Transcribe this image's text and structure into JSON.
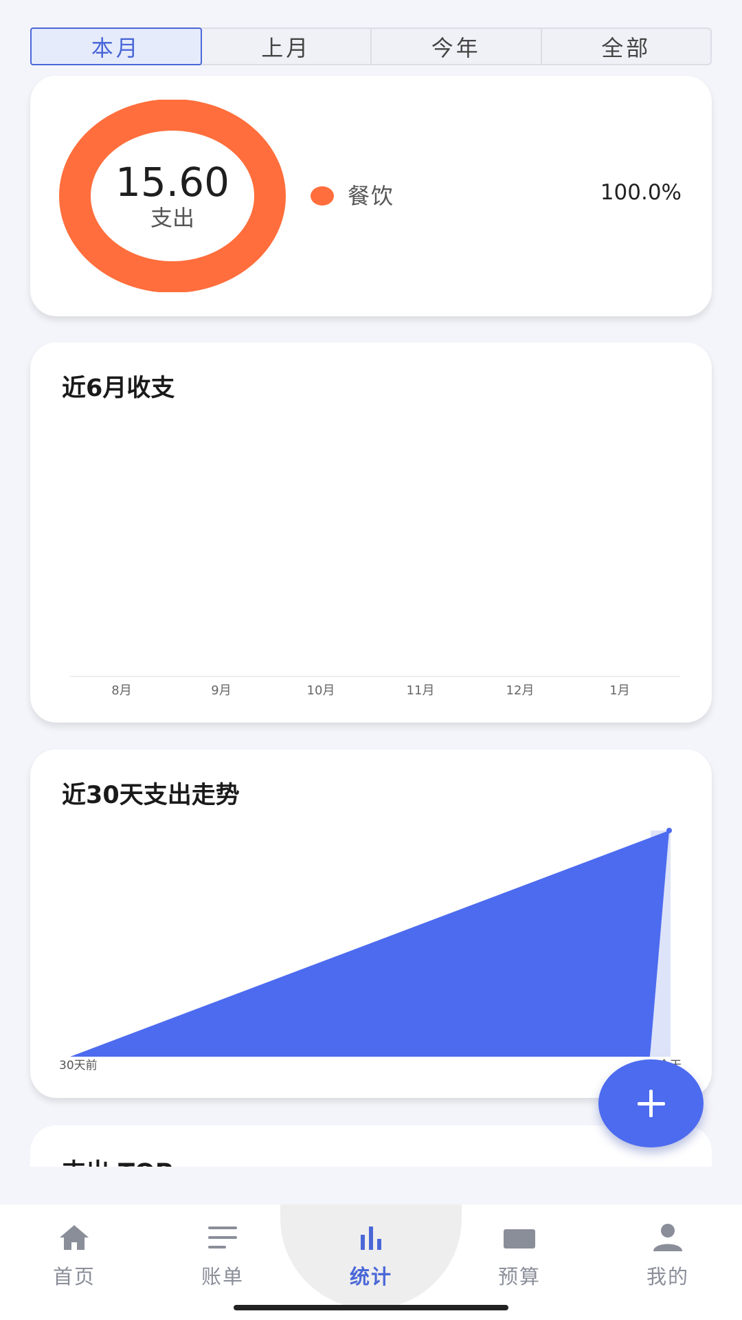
{
  "tabs": [
    {
      "label": "本月",
      "active": true
    },
    {
      "label": "上月",
      "active": false
    },
    {
      "label": "今年",
      "active": false
    },
    {
      "label": "全部",
      "active": false
    }
  ],
  "donut": {
    "amount": "15.60",
    "label": "支出",
    "segments": [
      {
        "name": "餐饮",
        "percent": "100.0%",
        "fraction": 1.0,
        "color": "#ff6e3c"
      }
    ]
  },
  "six_month": {
    "title": "近6月收支",
    "months": [
      "8月",
      "9月",
      "10月",
      "11月",
      "12月",
      "1月"
    ]
  },
  "trend": {
    "title": "近30天支出走势",
    "start_label": "30天前",
    "end_label": "今天",
    "fill_color": "#4d6bef"
  },
  "chart_data": [
    {
      "type": "bar",
      "title": "近6月收支",
      "categories": [
        "8月",
        "9月",
        "10月",
        "11月",
        "12月",
        "1月"
      ],
      "values": []
    },
    {
      "type": "area",
      "title": "近30天支出走势",
      "x": [
        "30天前",
        "今天"
      ],
      "series": [
        {
          "values": [
            0,
            15.6
          ]
        }
      ]
    }
  ],
  "top_section": {
    "title": "支出 TOP"
  },
  "fab": {
    "icon": "plus-icon"
  },
  "nav": [
    {
      "label": "首页",
      "icon": "home-icon",
      "active": false
    },
    {
      "label": "账单",
      "icon": "list-icon",
      "active": false
    },
    {
      "label": "统计",
      "icon": "bar-chart-icon",
      "active": true
    },
    {
      "label": "预算",
      "icon": "wallet-icon",
      "active": false
    },
    {
      "label": "我的",
      "icon": "user-icon",
      "active": false
    }
  ],
  "colors": {
    "accent": "#4a67d8",
    "expense": "#ff6e3c"
  }
}
